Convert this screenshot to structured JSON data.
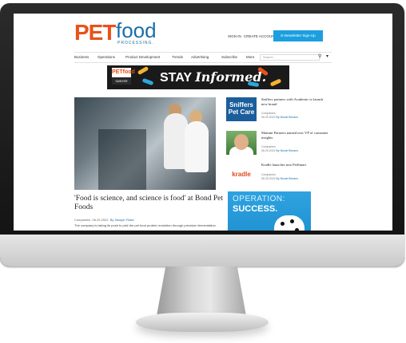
{
  "site": {
    "logo_pet": "PET",
    "logo_food": "food",
    "logo_sub": "PROCESSING.",
    "top_links": [
      "SIGN IN",
      "CREATE ACCOUNT"
    ],
    "signup_button": "E-Newsletter Sign-Up",
    "nav": [
      "Business",
      "Operations",
      "Product Development",
      "Trends",
      "Advertising",
      "Subscribe",
      "More"
    ],
    "search_placeholder": "Search",
    "accent_color": "#e8521a",
    "brand_color": "#1b6fa8"
  },
  "banner": {
    "brand": "PETfood",
    "brand_sub": "SAWYER",
    "text_plain": "STAY",
    "text_italic": "Informed."
  },
  "hero": {
    "headline": "'Food is science, and science is food' at Bond Pet Foods",
    "section": "Companies",
    "date": "06.29.2022",
    "author": "By Sawyer Flake",
    "excerpt": "The company is taking its push to pick the pet food protein revolution through precision fermentation."
  },
  "sidebar": [
    {
      "thumb": "Sniffers Pet Care",
      "title": "Sniffers partners with Academic to launch new brand",
      "section": "Companies",
      "date": "06.29.2022",
      "author": "By Nicole Bevans"
    },
    {
      "thumb": "",
      "title": "Mammi Partners named new VP of consumer insights",
      "section": "Companies",
      "date": "06.29.2022",
      "author": "By Nicole Bevans"
    },
    {
      "thumb": "kradle",
      "title": "Kradle launches into PetSmart",
      "section": "Companies",
      "date": "06.29.2022",
      "author": "By Nicole Bevans"
    }
  ],
  "ad": {
    "line1": "OPERATION:",
    "line2": "SUCCESS."
  }
}
